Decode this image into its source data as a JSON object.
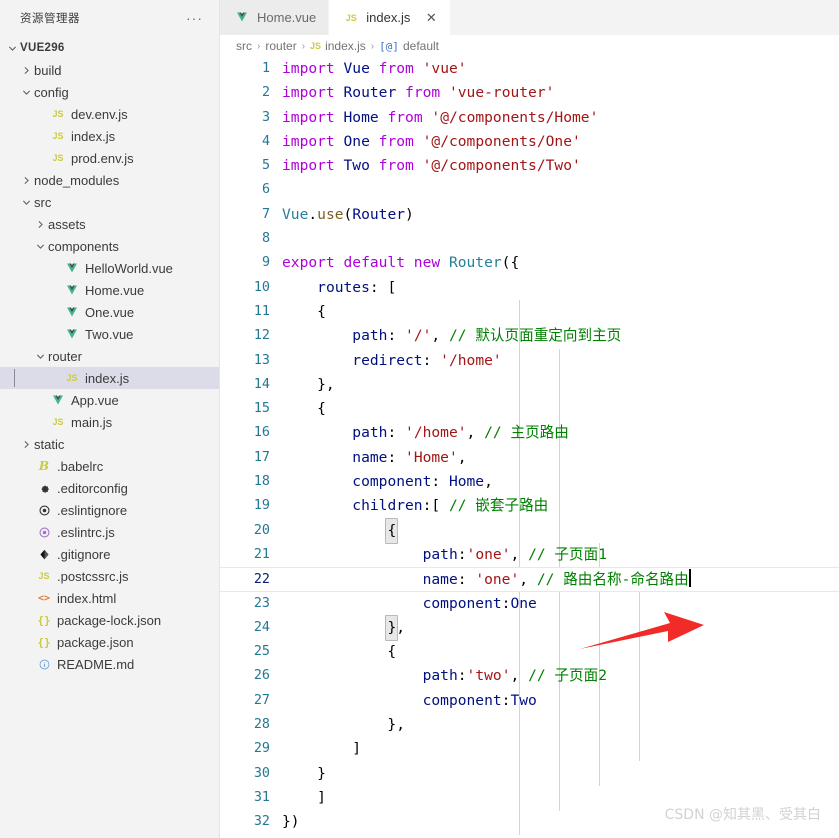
{
  "sidebar": {
    "title": "资源管理器",
    "more_label": "···",
    "root": "VUE296",
    "items": [
      {
        "label": "build",
        "type": "folder",
        "state": "collapsed",
        "depth": 1
      },
      {
        "label": "config",
        "type": "folder",
        "state": "expanded",
        "depth": 1
      },
      {
        "label": "dev.env.js",
        "type": "js",
        "depth": 2
      },
      {
        "label": "index.js",
        "type": "js",
        "depth": 2
      },
      {
        "label": "prod.env.js",
        "type": "js",
        "depth": 2
      },
      {
        "label": "node_modules",
        "type": "folder",
        "state": "collapsed",
        "depth": 1
      },
      {
        "label": "src",
        "type": "folder",
        "state": "expanded",
        "depth": 1
      },
      {
        "label": "assets",
        "type": "folder",
        "state": "collapsed",
        "depth": 2
      },
      {
        "label": "components",
        "type": "folder",
        "state": "expanded",
        "depth": 2
      },
      {
        "label": "HelloWorld.vue",
        "type": "vue",
        "depth": 3
      },
      {
        "label": "Home.vue",
        "type": "vue",
        "depth": 3
      },
      {
        "label": "One.vue",
        "type": "vue",
        "depth": 3
      },
      {
        "label": "Two.vue",
        "type": "vue",
        "depth": 3
      },
      {
        "label": "router",
        "type": "folder",
        "state": "expanded",
        "depth": 2
      },
      {
        "label": "index.js",
        "type": "js",
        "depth": 3,
        "selected": true
      },
      {
        "label": "App.vue",
        "type": "vue",
        "depth": 2
      },
      {
        "label": "main.js",
        "type": "js",
        "depth": 2
      },
      {
        "label": "static",
        "type": "folder",
        "state": "collapsed",
        "depth": 1
      },
      {
        "label": ".babelrc",
        "type": "babel",
        "depth": 1
      },
      {
        "label": ".editorconfig",
        "type": "gear",
        "depth": 1
      },
      {
        "label": ".eslintignore",
        "type": "eslint-gray",
        "depth": 1
      },
      {
        "label": ".eslintrc.js",
        "type": "eslint-purple",
        "depth": 1
      },
      {
        "label": ".gitignore",
        "type": "git",
        "depth": 1
      },
      {
        "label": ".postcssrc.js",
        "type": "js",
        "depth": 1
      },
      {
        "label": "index.html",
        "type": "html",
        "depth": 1
      },
      {
        "label": "package-lock.json",
        "type": "json",
        "depth": 1
      },
      {
        "label": "package.json",
        "type": "json",
        "depth": 1
      },
      {
        "label": "README.md",
        "type": "md",
        "depth": 1
      }
    ]
  },
  "tabs": [
    {
      "label": "Home.vue",
      "icon": "vue-icon",
      "active": false,
      "closable": false
    },
    {
      "label": "index.js",
      "icon": "js-icon",
      "active": true,
      "closable": true,
      "close_label": "✕"
    }
  ],
  "breadcrumb": {
    "items": [
      "src",
      "router",
      "index.js",
      "default"
    ],
    "separator": "›"
  },
  "editor": {
    "cursor_line": 22,
    "lines": [
      {
        "n": 1,
        "tokens": [
          {
            "t": "import ",
            "c": "kw"
          },
          {
            "t": "Vue",
            "c": "id"
          },
          {
            "t": " ",
            "c": "plain"
          },
          {
            "t": "from",
            "c": "kw"
          },
          {
            "t": " ",
            "c": "plain"
          },
          {
            "t": "'vue'",
            "c": "str"
          }
        ]
      },
      {
        "n": 2,
        "tokens": [
          {
            "t": "import ",
            "c": "kw"
          },
          {
            "t": "Router",
            "c": "id"
          },
          {
            "t": " ",
            "c": "plain"
          },
          {
            "t": "from",
            "c": "kw"
          },
          {
            "t": " ",
            "c": "plain"
          },
          {
            "t": "'vue-router'",
            "c": "str"
          }
        ]
      },
      {
        "n": 3,
        "tokens": [
          {
            "t": "import ",
            "c": "kw"
          },
          {
            "t": "Home",
            "c": "id"
          },
          {
            "t": " ",
            "c": "plain"
          },
          {
            "t": "from",
            "c": "kw"
          },
          {
            "t": " ",
            "c": "plain"
          },
          {
            "t": "'@/components/Home'",
            "c": "str"
          }
        ]
      },
      {
        "n": 4,
        "tokens": [
          {
            "t": "import ",
            "c": "kw"
          },
          {
            "t": "One",
            "c": "id"
          },
          {
            "t": " ",
            "c": "plain"
          },
          {
            "t": "from",
            "c": "kw"
          },
          {
            "t": " ",
            "c": "plain"
          },
          {
            "t": "'@/components/One'",
            "c": "str"
          }
        ]
      },
      {
        "n": 5,
        "tokens": [
          {
            "t": "import ",
            "c": "kw"
          },
          {
            "t": "Two",
            "c": "id"
          },
          {
            "t": " ",
            "c": "plain"
          },
          {
            "t": "from",
            "c": "kw"
          },
          {
            "t": " ",
            "c": "plain"
          },
          {
            "t": "'@/components/Two'",
            "c": "str"
          }
        ]
      },
      {
        "n": 6,
        "tokens": []
      },
      {
        "n": 7,
        "tokens": [
          {
            "t": "Vue",
            "c": "cls"
          },
          {
            "t": ".",
            "c": "plain"
          },
          {
            "t": "use",
            "c": "fn"
          },
          {
            "t": "(",
            "c": "plain"
          },
          {
            "t": "Router",
            "c": "id"
          },
          {
            "t": ")",
            "c": "plain"
          }
        ]
      },
      {
        "n": 8,
        "tokens": []
      },
      {
        "n": 9,
        "tokens": [
          {
            "t": "export default ",
            "c": "kw"
          },
          {
            "t": "new",
            "c": "kw"
          },
          {
            "t": " ",
            "c": "plain"
          },
          {
            "t": "Router",
            "c": "cls"
          },
          {
            "t": "({",
            "c": "plain"
          }
        ]
      },
      {
        "n": 10,
        "tokens": [
          {
            "t": "    ",
            "c": "plain"
          },
          {
            "t": "routes",
            "c": "id"
          },
          {
            "t": ": [",
            "c": "plain"
          }
        ]
      },
      {
        "n": 11,
        "tokens": [
          {
            "t": "    {",
            "c": "plain"
          }
        ]
      },
      {
        "n": 12,
        "tokens": [
          {
            "t": "        ",
            "c": "plain"
          },
          {
            "t": "path",
            "c": "id"
          },
          {
            "t": ": ",
            "c": "plain"
          },
          {
            "t": "'/'",
            "c": "str"
          },
          {
            "t": ", ",
            "c": "plain"
          },
          {
            "t": "// 默认页面重定向到主页",
            "c": "cm"
          }
        ]
      },
      {
        "n": 13,
        "tokens": [
          {
            "t": "        ",
            "c": "plain"
          },
          {
            "t": "redirect",
            "c": "id"
          },
          {
            "t": ": ",
            "c": "plain"
          },
          {
            "t": "'/home'",
            "c": "str"
          }
        ]
      },
      {
        "n": 14,
        "tokens": [
          {
            "t": "    },",
            "c": "plain"
          }
        ]
      },
      {
        "n": 15,
        "tokens": [
          {
            "t": "    {",
            "c": "plain"
          }
        ]
      },
      {
        "n": 16,
        "tokens": [
          {
            "t": "        ",
            "c": "plain"
          },
          {
            "t": "path",
            "c": "id"
          },
          {
            "t": ": ",
            "c": "plain"
          },
          {
            "t": "'/home'",
            "c": "str"
          },
          {
            "t": ", ",
            "c": "plain"
          },
          {
            "t": "// 主页路由",
            "c": "cm"
          }
        ]
      },
      {
        "n": 17,
        "tokens": [
          {
            "t": "        ",
            "c": "plain"
          },
          {
            "t": "name",
            "c": "id"
          },
          {
            "t": ": ",
            "c": "plain"
          },
          {
            "t": "'Home'",
            "c": "str"
          },
          {
            "t": ",",
            "c": "plain"
          }
        ]
      },
      {
        "n": 18,
        "tokens": [
          {
            "t": "        ",
            "c": "plain"
          },
          {
            "t": "component",
            "c": "id"
          },
          {
            "t": ": ",
            "c": "plain"
          },
          {
            "t": "Home",
            "c": "id"
          },
          {
            "t": ",",
            "c": "plain"
          }
        ]
      },
      {
        "n": 19,
        "tokens": [
          {
            "t": "        ",
            "c": "plain"
          },
          {
            "t": "children",
            "c": "id"
          },
          {
            "t": ":[ ",
            "c": "plain"
          },
          {
            "t": "// 嵌套子路由",
            "c": "cm"
          }
        ]
      },
      {
        "n": 20,
        "tokens": [
          {
            "t": "            ",
            "c": "plain"
          },
          {
            "t": "{",
            "c": "plain",
            "match": true
          }
        ]
      },
      {
        "n": 21,
        "tokens": [
          {
            "t": "                ",
            "c": "plain"
          },
          {
            "t": "path",
            "c": "id"
          },
          {
            "t": ":",
            "c": "plain"
          },
          {
            "t": "'one'",
            "c": "str"
          },
          {
            "t": ", ",
            "c": "plain"
          },
          {
            "t": "// 子页面1",
            "c": "cm"
          }
        ]
      },
      {
        "n": 22,
        "tokens": [
          {
            "t": "                ",
            "c": "plain"
          },
          {
            "t": "name",
            "c": "id"
          },
          {
            "t": ": ",
            "c": "plain"
          },
          {
            "t": "'one'",
            "c": "str"
          },
          {
            "t": ", ",
            "c": "plain"
          },
          {
            "t": "// 路由名称-命名路由",
            "c": "cm"
          }
        ],
        "caret": true
      },
      {
        "n": 23,
        "tokens": [
          {
            "t": "                ",
            "c": "plain"
          },
          {
            "t": "component",
            "c": "id"
          },
          {
            "t": ":",
            "c": "plain"
          },
          {
            "t": "One",
            "c": "id"
          }
        ]
      },
      {
        "n": 24,
        "tokens": [
          {
            "t": "            ",
            "c": "plain"
          },
          {
            "t": "}",
            "c": "plain",
            "match": true
          },
          {
            "t": ",",
            "c": "plain"
          }
        ]
      },
      {
        "n": 25,
        "tokens": [
          {
            "t": "            {",
            "c": "plain"
          }
        ]
      },
      {
        "n": 26,
        "tokens": [
          {
            "t": "                ",
            "c": "plain"
          },
          {
            "t": "path",
            "c": "id"
          },
          {
            "t": ":",
            "c": "plain"
          },
          {
            "t": "'two'",
            "c": "str"
          },
          {
            "t": ", ",
            "c": "plain"
          },
          {
            "t": "// 子页面2",
            "c": "cm"
          }
        ]
      },
      {
        "n": 27,
        "tokens": [
          {
            "t": "                ",
            "c": "plain"
          },
          {
            "t": "component",
            "c": "id"
          },
          {
            "t": ":",
            "c": "plain"
          },
          {
            "t": "Two",
            "c": "id"
          }
        ]
      },
      {
        "n": 28,
        "tokens": [
          {
            "t": "            },",
            "c": "plain"
          }
        ]
      },
      {
        "n": 29,
        "tokens": [
          {
            "t": "        ]",
            "c": "plain"
          }
        ]
      },
      {
        "n": 30,
        "tokens": [
          {
            "t": "    }",
            "c": "plain"
          }
        ]
      },
      {
        "n": 31,
        "tokens": [
          {
            "t": "    ]",
            "c": "plain"
          }
        ]
      },
      {
        "n": 32,
        "tokens": [
          {
            "t": "})",
            "c": "plain"
          }
        ]
      }
    ]
  },
  "annotation": {
    "arrow_color": "#f02b28"
  },
  "watermark": "CSDN @知其黑、受其白"
}
